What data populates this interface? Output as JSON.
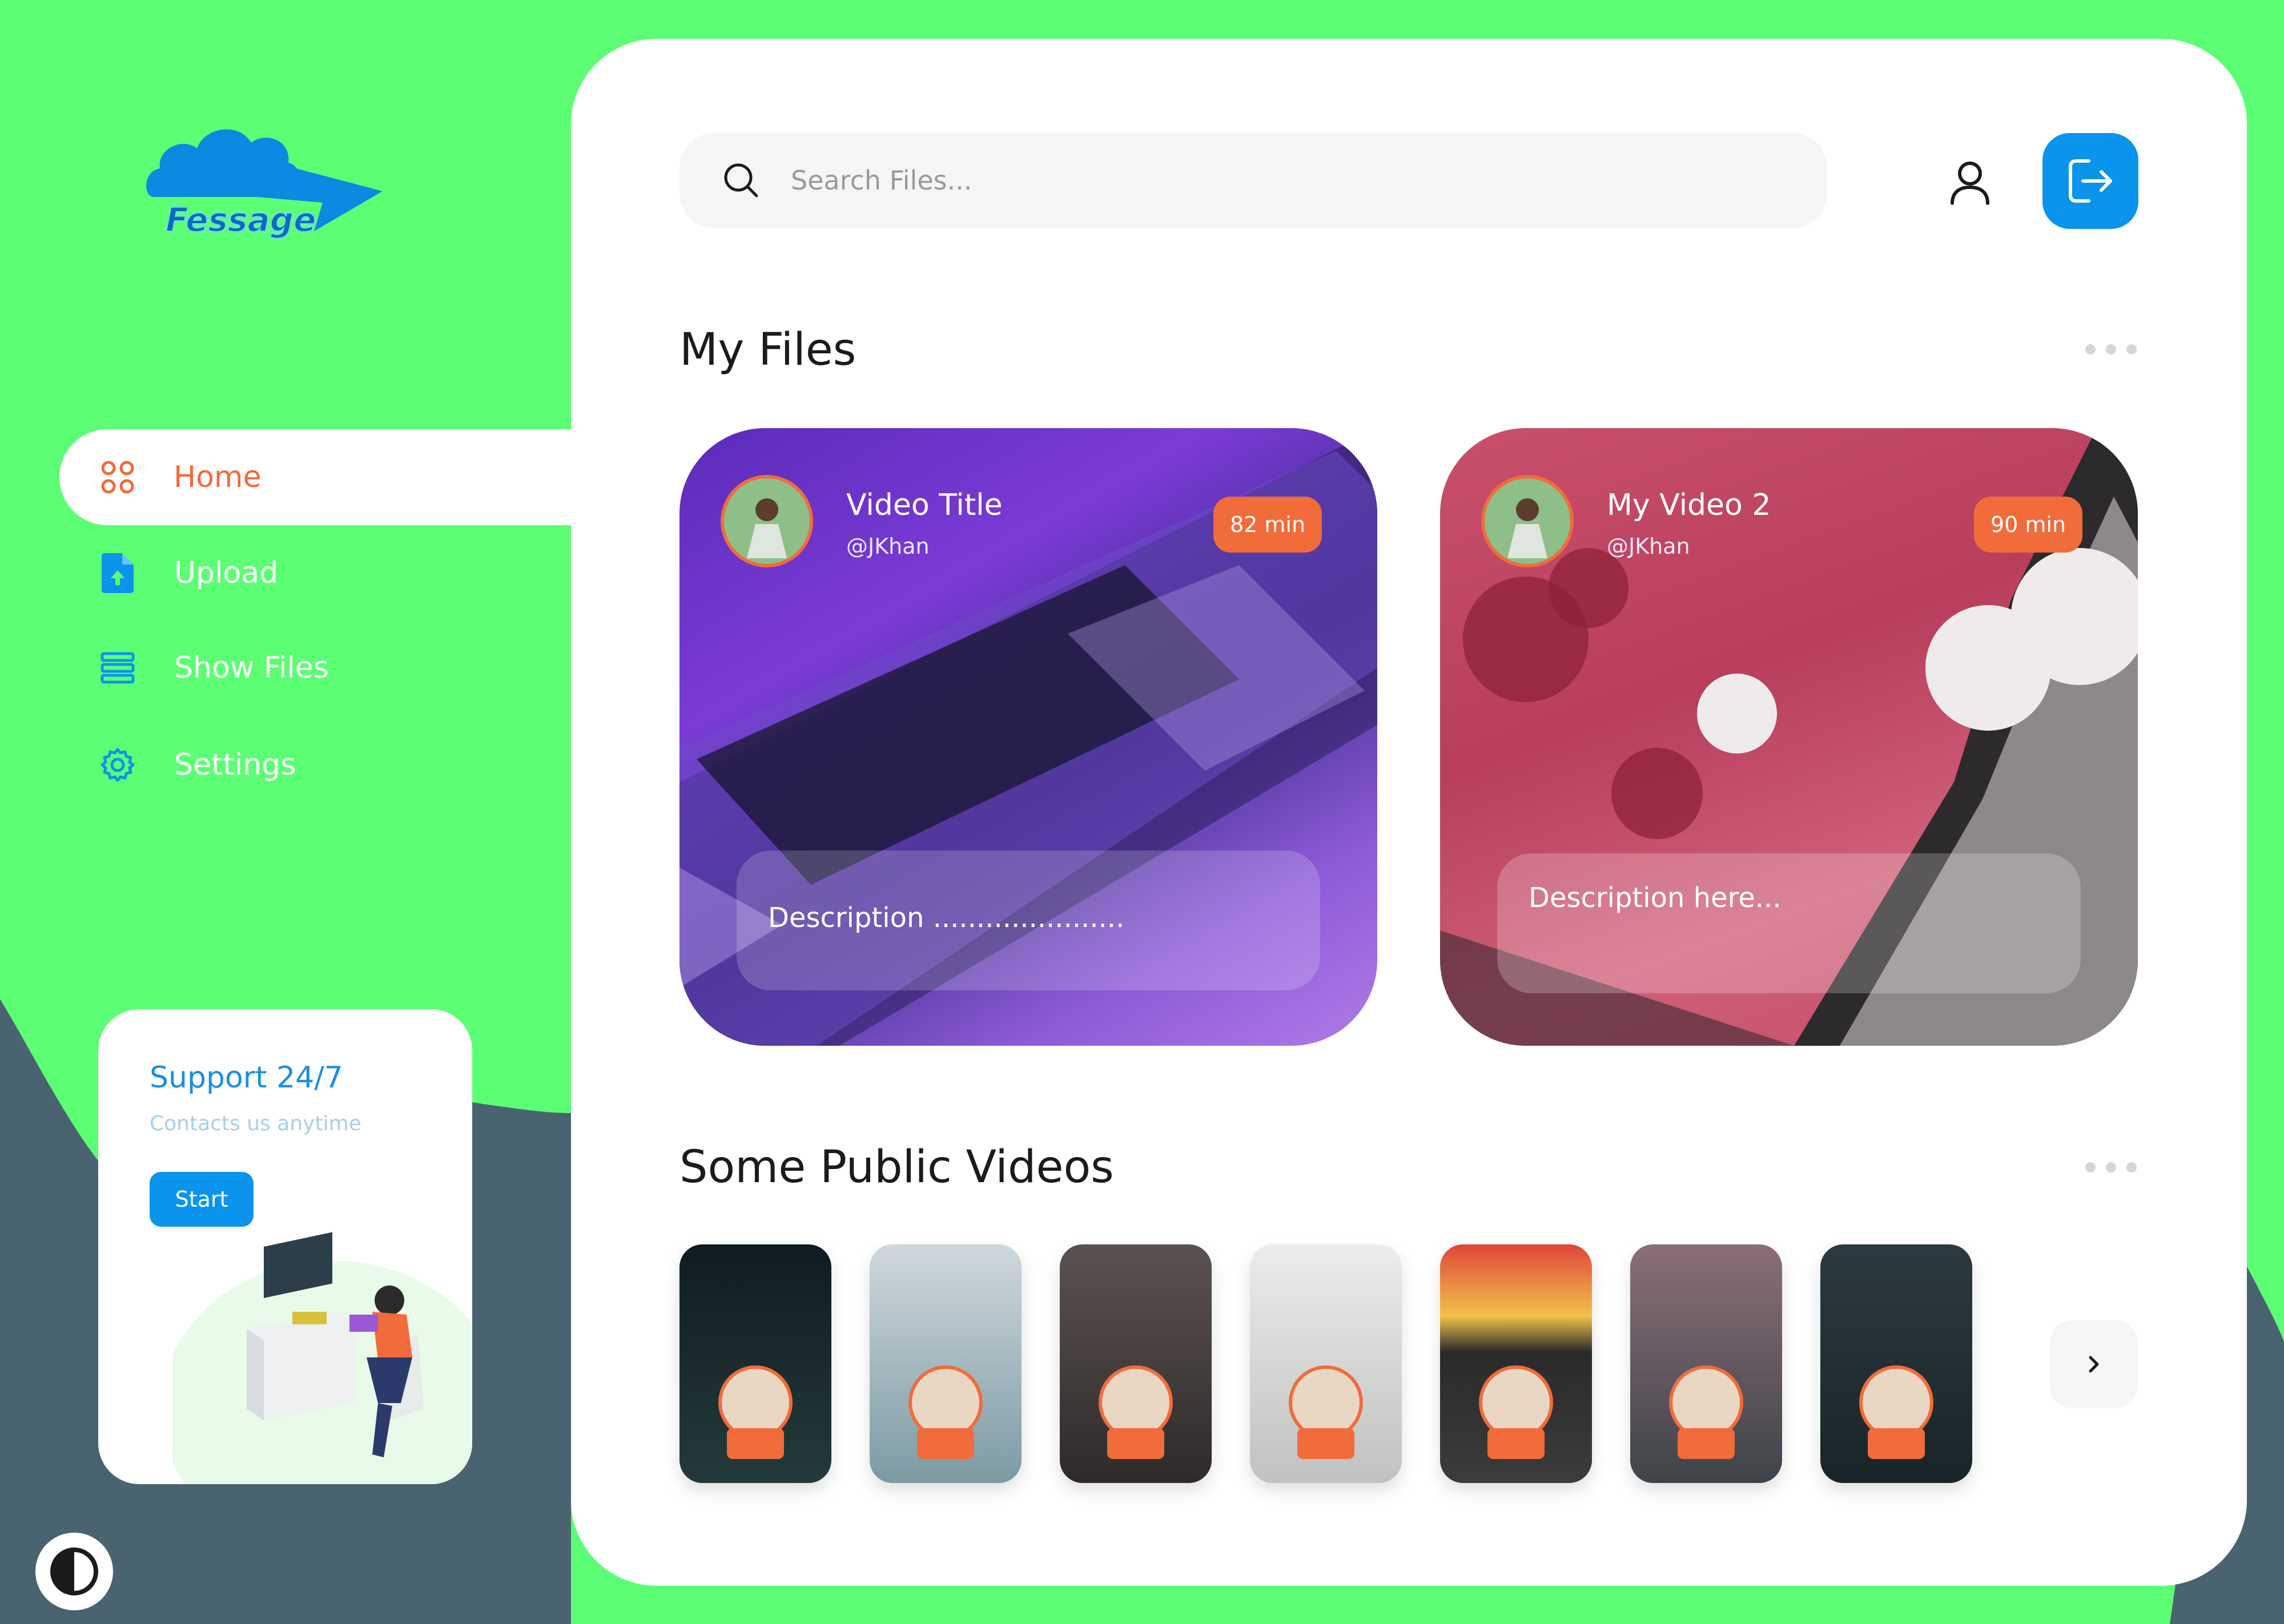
{
  "brand": {
    "name": "Fessage"
  },
  "colors": {
    "background": "#5cff74",
    "accent": "#0a94ec",
    "orange": "#f26b3a",
    "dark": "#4a6370"
  },
  "sidebar": {
    "items": [
      {
        "label": "Home",
        "icon": "grid-icon",
        "active": true
      },
      {
        "label": "Upload",
        "icon": "file-upload-icon"
      },
      {
        "label": "Show Files",
        "icon": "list-icon"
      },
      {
        "label": "Settings",
        "icon": "gear-icon"
      }
    ]
  },
  "support": {
    "title": "Support 24/7",
    "subtitle": "Contacts us anytime",
    "button": "Start"
  },
  "header": {
    "search_placeholder": "Search Files..."
  },
  "my_files": {
    "title": "My Files",
    "cards": [
      {
        "title": "Video Title",
        "handle": "@JKhan",
        "duration": "82 min",
        "description": "Description ......................"
      },
      {
        "title": "My Video 2",
        "handle": "@JKhan",
        "duration": "90 min",
        "description": "Description here..."
      }
    ]
  },
  "public_videos": {
    "title": "Some Public Videos",
    "count": 7
  }
}
